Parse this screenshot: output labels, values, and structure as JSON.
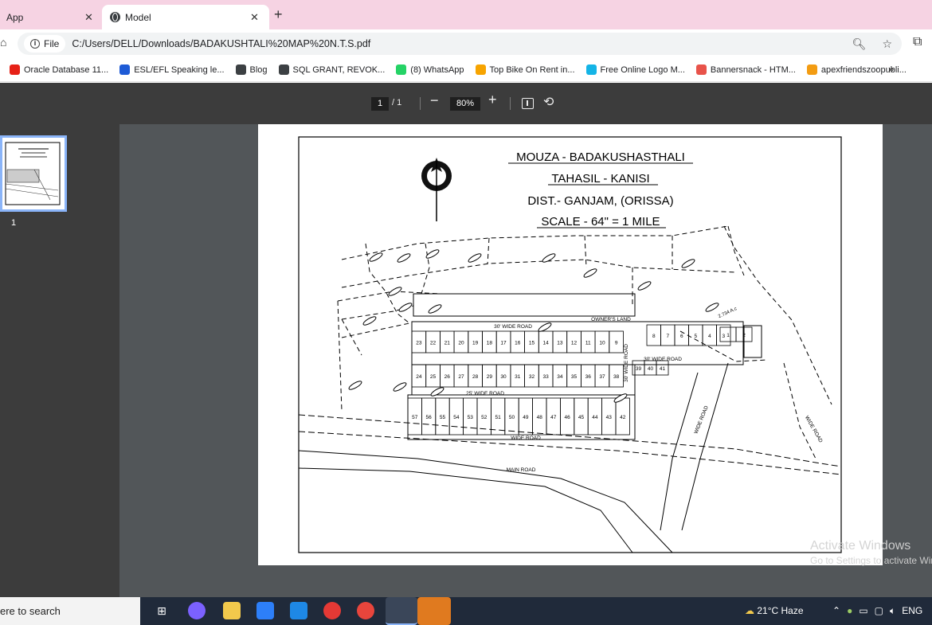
{
  "browser": {
    "tabs": [
      {
        "title": "App",
        "active": false
      },
      {
        "title": "Model",
        "active": true
      }
    ],
    "new_tab_glyph": "+",
    "close_glyph": "✕",
    "site_chip_label": "File",
    "url": "C:/Users/DELL/Downloads/BADAKUSHTALI%20MAP%20N.T.S.pdf",
    "bookmarks": [
      {
        "label": "Oracle Database 11...",
        "icon": "youtube-icon",
        "color": "#e62117"
      },
      {
        "label": "ESL/EFL Speaking le...",
        "icon": "esl-icon",
        "color": "#1e5bd6"
      },
      {
        "label": "Blog",
        "icon": "globe-icon",
        "color": "#3c4043"
      },
      {
        "label": "SQL GRANT, REVOK...",
        "icon": "globe-icon",
        "color": "#3c4043"
      },
      {
        "label": "(8) WhatsApp",
        "icon": "whatsapp-icon",
        "color": "#25d366"
      },
      {
        "label": "Top Bike On Rent in...",
        "icon": "justdial-icon",
        "color": "#f7a400"
      },
      {
        "label": "Free Online Logo M...",
        "icon": "logo-maker-icon",
        "color": "#14b4e6"
      },
      {
        "label": "Bannersnack - HTM...",
        "icon": "bannersnack-icon",
        "color": "#e8534a"
      },
      {
        "label": "apexfriendszoopubli...",
        "icon": "cloud-icon",
        "color": "#f39c12"
      }
    ],
    "more_bookmarks_glyph": "»"
  },
  "pdf": {
    "current_page": "1",
    "total_pages": "/ 1",
    "zoom": "80%",
    "thumbnail_label": "1",
    "map": {
      "title_lines": [
        "MOUZA - BADAKUSHASTHALI",
        "TAHASIL - KANISI",
        "DIST.- GANJAM, (ORISSA)",
        "SCALE - 64\" = 1 MILE"
      ],
      "road_labels": [
        "30' WIDE ROAD",
        "25' WIDE ROAD",
        "WIDE ROAD",
        "MAIN ROAD",
        "30' WIDE ROAD",
        "30' WIDE ROAD",
        "WIDE ROAD",
        "WIDE ROAD"
      ],
      "area_labels": [
        "OWNER'S LAND",
        "2.734 A.c"
      ],
      "row1_plots": [
        "23",
        "22",
        "21",
        "20",
        "19",
        "18",
        "17",
        "16",
        "15",
        "14",
        "13",
        "12",
        "11",
        "10",
        "9"
      ],
      "row2_plots": [
        "24",
        "25",
        "26",
        "27",
        "28",
        "29",
        "30",
        "31",
        "32",
        "33",
        "34",
        "35",
        "36",
        "37",
        "38"
      ],
      "row3_plots": [
        "57",
        "56",
        "55",
        "54",
        "53",
        "52",
        "51",
        "50",
        "49",
        "48",
        "47",
        "46",
        "45",
        "44",
        "43",
        "42"
      ],
      "east_plots": [
        "8",
        "7",
        "6",
        "5",
        "4",
        "3"
      ],
      "east_small_plots": [
        "39",
        "40",
        "41"
      ],
      "corner_plots": [
        "1",
        "2"
      ]
    }
  },
  "watermark": {
    "title": "Activate Windows",
    "subtitle": "Go to Settings to activate Windows."
  },
  "taskbar": {
    "search_placeholder": "ere to search",
    "weather": "21°C  Haze",
    "language": "ENG"
  }
}
